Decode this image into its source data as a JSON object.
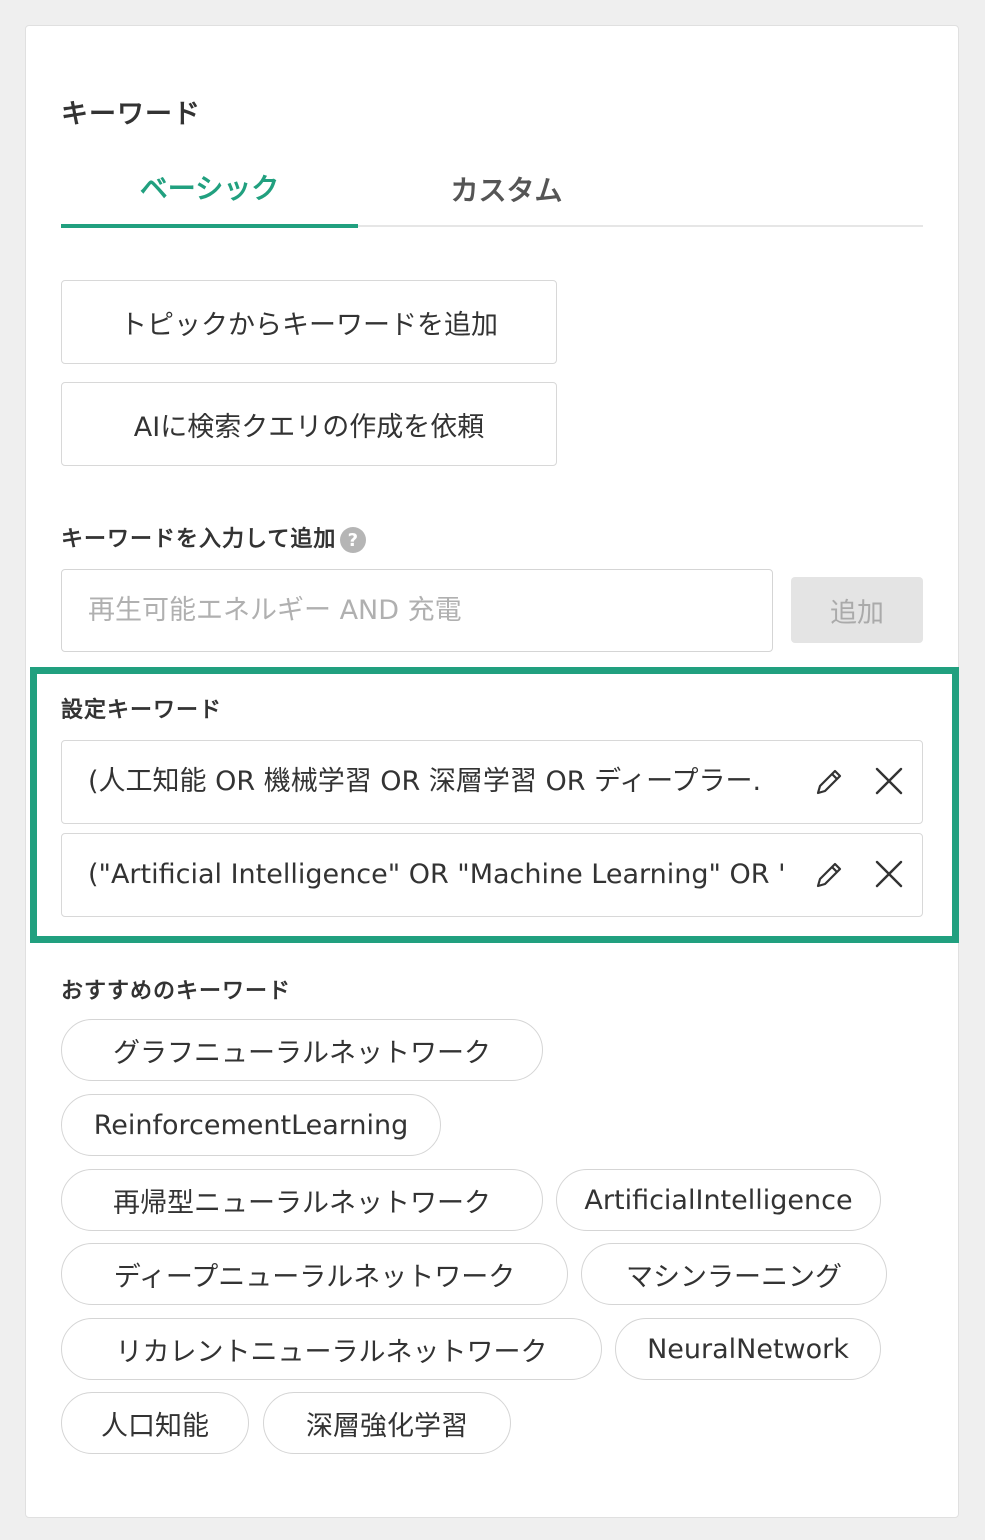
{
  "panel": {
    "title": "キーワード",
    "tabs": [
      {
        "label": "ベーシック"
      },
      {
        "label": "カスタム"
      }
    ],
    "topic_button_label": "トピックからキーワードを追加",
    "ai_button_label": "AIに検索クエリの作成を依頼",
    "input_label": "キーワードを入力して追加",
    "input_placeholder": "再生可能エネルギー AND 充電",
    "input_value": "",
    "add_button_label": "追加",
    "set_keywords_label": "設定キーワード",
    "set_keywords": [
      {
        "text": "(人工知能 OR 機械学習 OR 深層学習 OR ディープラー."
      },
      {
        "text": "(\"Artificial Intelligence\" OR \"Machine Learning\" OR '"
      }
    ],
    "recommended_label": "おすすめのキーワード",
    "recommended": [
      "グラフニューラルネットワーク",
      "ReinforcementLearning",
      "再帰型ニューラルネットワーク",
      "ArtificialIntelligence",
      "ディープニューラルネットワーク",
      "マシンラーニング",
      "リカレントニューラルネットワーク",
      "NeuralNetwork",
      "人口知能",
      "深層強化学習"
    ],
    "accent_color": "#21a07f"
  }
}
